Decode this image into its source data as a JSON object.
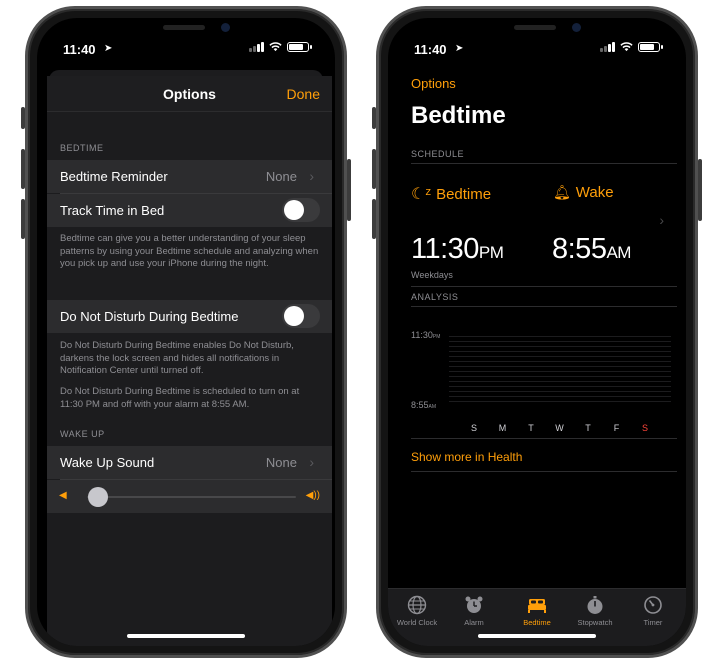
{
  "left_phone": {
    "status": {
      "time": "11:40"
    },
    "header": {
      "title": "Options",
      "done_label": "Done"
    },
    "bedtime_section": {
      "label": "BEDTIME",
      "reminder_label": "Bedtime Reminder",
      "reminder_value": "None",
      "track_label": "Track Time in Bed",
      "track_on": false,
      "track_footnote": "Bedtime can give you a better understanding of your sleep patterns by using your Bedtime schedule and analyzing when you pick up and use your iPhone during the night.",
      "dnd_label": "Do Not Disturb During Bedtime",
      "dnd_on": false,
      "dnd_footnote_1": "Do Not Disturb During Bedtime enables Do Not Disturb, darkens the lock screen and hides all notifications in Notification Center until turned off.",
      "dnd_footnote_2": "Do Not Disturb During Bedtime is scheduled to turn on at 11:30 PM and off with your alarm at 8:55 AM."
    },
    "wakeup_section": {
      "label": "WAKE UP",
      "sound_label": "Wake Up Sound",
      "sound_value": "None",
      "volume_level": 0.05
    }
  },
  "right_phone": {
    "status": {
      "time": "11:40"
    },
    "back_label": "Options",
    "title": "Bedtime",
    "schedule_section": "SCHEDULE",
    "bedtime_label": "Bedtime",
    "wake_label": "Wake",
    "bedtime_time": "11:30",
    "bedtime_ampm": "PM",
    "wake_time": "8:55",
    "wake_ampm": "AM",
    "weekdays_label": "Weekdays",
    "analysis_section": "ANALYSIS",
    "chart_ylabels": {
      "top": "11:30",
      "top_ampm": "PM",
      "bottom": "8:55",
      "bottom_ampm": "AM"
    },
    "chart_days": [
      "S",
      "M",
      "T",
      "W",
      "T",
      "F",
      "S"
    ],
    "health_link": "Show more in Health",
    "tabs": [
      {
        "label": "World Clock",
        "icon": "globe-icon",
        "active": false
      },
      {
        "label": "Alarm",
        "icon": "alarm-clock-icon",
        "active": false
      },
      {
        "label": "Bedtime",
        "icon": "bed-icon",
        "active": true
      },
      {
        "label": "Stopwatch",
        "icon": "stopwatch-icon",
        "active": false
      },
      {
        "label": "Timer",
        "icon": "timer-icon",
        "active": false
      }
    ]
  },
  "colors": {
    "accent": "#ff9f0a",
    "background": "#000000",
    "cell": "#2c2c2e",
    "secondary_text": "#8e8e93",
    "weekend_red": "#ff453a"
  }
}
